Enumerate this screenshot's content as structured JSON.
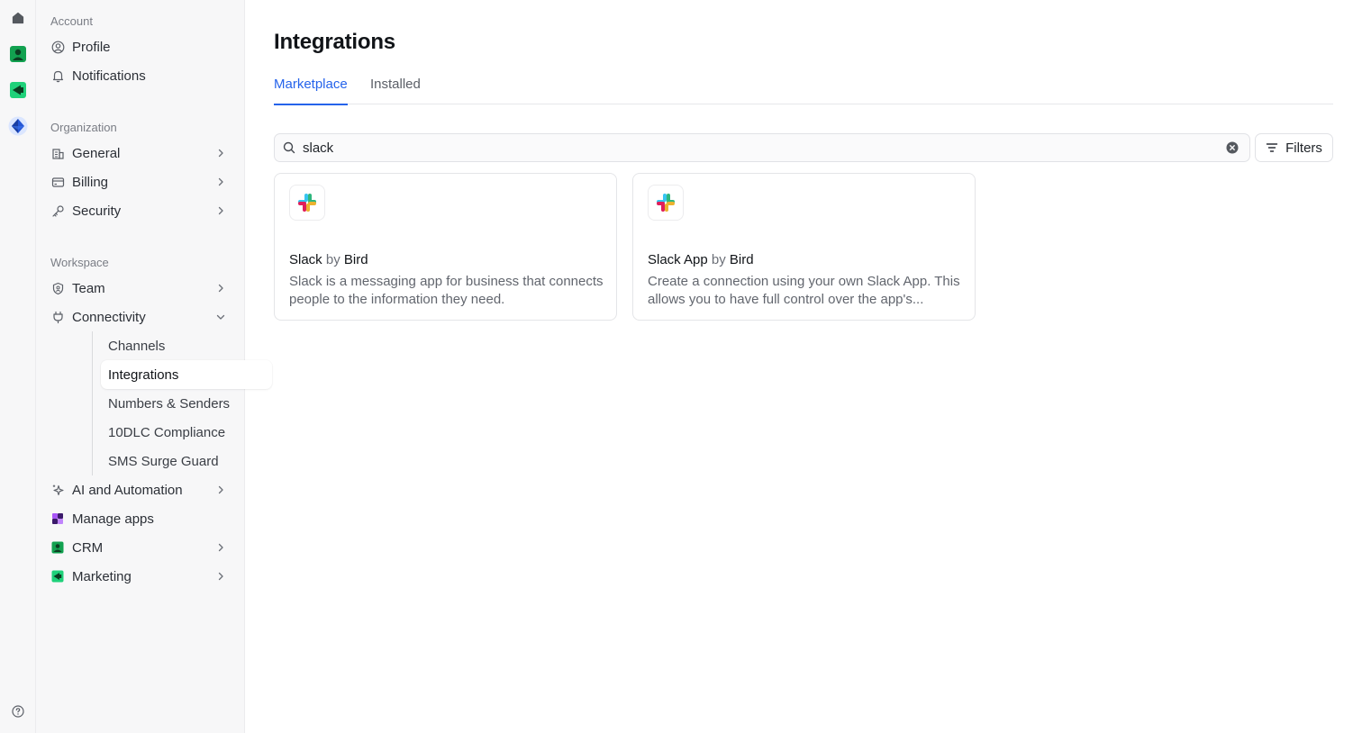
{
  "sidebar": {
    "sections": {
      "account": "Account",
      "organization": "Organization",
      "workspace": "Workspace"
    },
    "items": {
      "profile": "Profile",
      "notifications": "Notifications",
      "general": "General",
      "billing": "Billing",
      "security": "Security",
      "team": "Team",
      "connectivity": "Connectivity",
      "ai_automation": "AI and Automation",
      "manage_apps": "Manage apps",
      "crm": "CRM",
      "marketing": "Marketing"
    },
    "connectivity_sub": {
      "channels": "Channels",
      "integrations": "Integrations",
      "numbers_senders": "Numbers & Senders",
      "tendlc": "10DLC Compliance",
      "sms_surge": "SMS Surge Guard"
    },
    "active_item": "Integrations"
  },
  "main": {
    "title": "Integrations",
    "tabs": [
      {
        "label": "Marketplace",
        "active": true
      },
      {
        "label": "Installed",
        "active": false
      }
    ],
    "search": {
      "value": "slack",
      "placeholder": ""
    },
    "filters_label": "Filters",
    "cards": [
      {
        "name": "Slack",
        "by": "by",
        "vendor": "Bird",
        "description": "Slack is a messaging app for business that connects people to the information they need.",
        "icon": "slack-logo-icon"
      },
      {
        "name": "Slack App",
        "by": "by",
        "vendor": "Bird",
        "description": "Create a connection using your own Slack App. This allows you to have full control over the app's...",
        "icon": "slack-logo-icon"
      }
    ]
  },
  "rail": {
    "icons": [
      "home-icon",
      "crm-app-icon",
      "marketing-app-icon",
      "bird-app-icon",
      "help-icon"
    ]
  },
  "colors": {
    "accent": "#2563eb",
    "sidebar_bg": "#f7f7f8",
    "crm_green": "#12a150",
    "marketing_green": "#16c172"
  }
}
